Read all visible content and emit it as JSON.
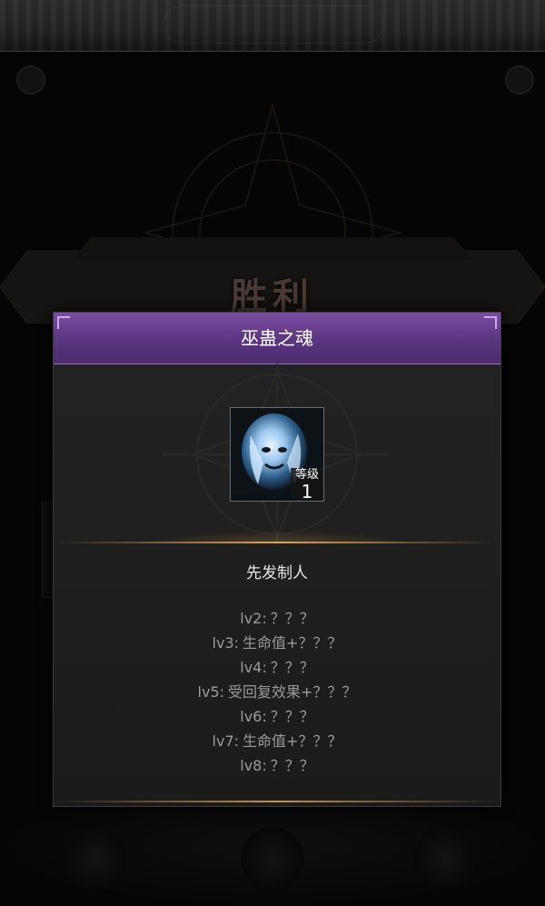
{
  "background": {
    "title": "胜利"
  },
  "dialog": {
    "title": "巫蛊之魂",
    "item": {
      "icon": "ghost-portrait-icon",
      "level_label": "等级",
      "level_value": "1"
    },
    "item_name": "先发制人",
    "effects": [
      {
        "level": "lv2",
        "text": "？？？"
      },
      {
        "level": "lv3",
        "text": "生命值+？？？"
      },
      {
        "level": "lv4",
        "text": "？？？"
      },
      {
        "level": "lv5",
        "text": "受回复效果+？？？"
      },
      {
        "level": "lv6",
        "text": "？？？"
      },
      {
        "level": "lv7",
        "text": "生命值+？？？"
      },
      {
        "level": "lv8",
        "text": "？？？"
      }
    ]
  },
  "colors": {
    "header_purple": "#5b3580",
    "accent_gold": "#d8a45a",
    "panel_bg": "#1f1f1f",
    "text_muted": "#9b9b9b"
  }
}
